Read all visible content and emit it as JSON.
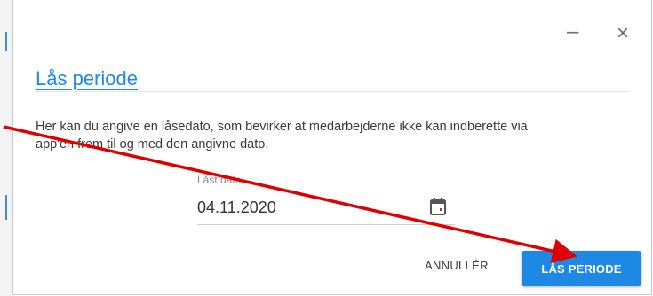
{
  "dialog": {
    "title": "Lås periode",
    "description": "Her kan du angive en låsedato, som bevirker at medarbejderne ikke kan indberette via app'en frem til og med den angivne dato.",
    "minimize_symbol": "–",
    "close_symbol": "×"
  },
  "date_field": {
    "label": "Låst dato",
    "value": "04.11.2020",
    "icon": "calendar-icon"
  },
  "actions": {
    "cancel_label": "ANNULLÉR",
    "lock_label": "LÅS PERIODE"
  },
  "colors": {
    "accent": "#1e88e5",
    "annotation_arrow": "#e00000"
  }
}
